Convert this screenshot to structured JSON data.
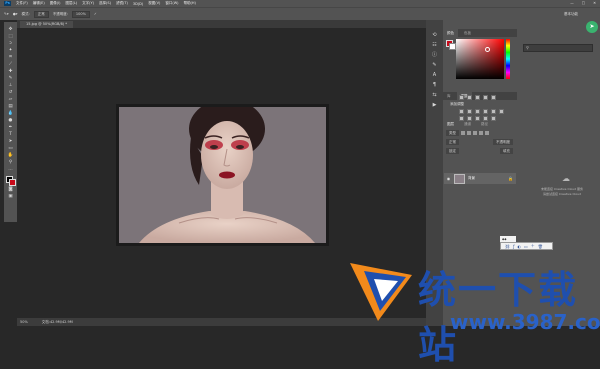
{
  "menubar": {
    "logo": "Ps",
    "items": [
      "文件(F)",
      "编辑(E)",
      "图像(I)",
      "图层(L)",
      "文字(Y)",
      "选择(S)",
      "滤镜(T)",
      "3D(D)",
      "视图(V)",
      "窗口(W)",
      "帮助(H)"
    ],
    "window_controls": [
      "—",
      "□",
      "✕"
    ]
  },
  "options": {
    "mode_label": "模式:",
    "mode_value": "正常",
    "opacity_label": "不透明度:",
    "opacity_value": "100%",
    "workspace": "基本功能"
  },
  "document": {
    "tab_title": "15.jpg @ 50%(RGB/8) *"
  },
  "status": {
    "zoom": "50%",
    "doc_info": "文档:42.9M/42.9M"
  },
  "panels": {
    "color_tabs": [
      "颜色",
      "色板"
    ],
    "style_tabs": [
      "库",
      "调整"
    ],
    "adjust_title": "添加调整",
    "layers_tabs": [
      "图层",
      "通道",
      "路径"
    ],
    "kind_label": "类型",
    "blend_mode": "正常",
    "opacity_label": "不透明度",
    "lock_label": "锁定",
    "fill_label": "填充",
    "layer_name": "背景"
  },
  "right_panel": {
    "line1": "未能连接 Creative Cloud 服务",
    "line2": "请尝试连接 Creative Cloud"
  },
  "watermark": {
    "title": "统一下载站",
    "url": "www.3987.com"
  },
  "colors": {
    "foreground": "#c80a1a",
    "background": "#000000",
    "accent": "#31a8ff"
  }
}
